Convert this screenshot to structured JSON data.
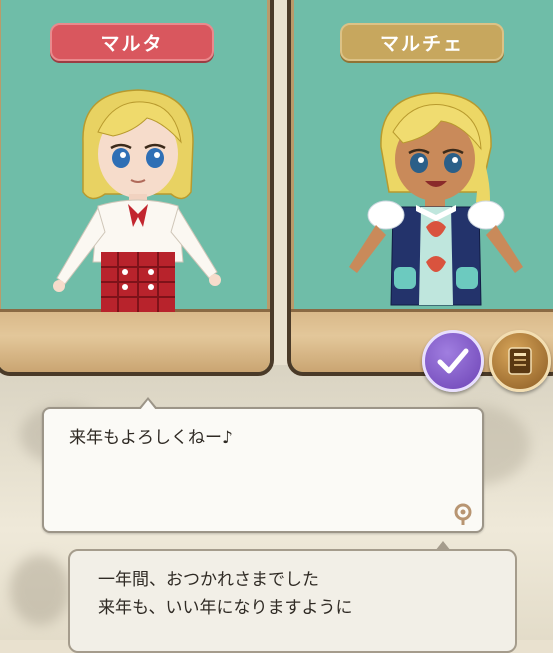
{
  "characters": {
    "left": {
      "name": "マルタ",
      "tag_color": "#d9575e"
    },
    "right": {
      "name": "マルチェ",
      "tag_color": "#c7a75e"
    }
  },
  "controls": {
    "confirm_icon": "check-icon",
    "log_icon": "log-book-icon"
  },
  "dialogue": {
    "speech": "来年もよろしくねー♪",
    "message_lines": [
      "一年間、おつかれさまでした",
      "来年も、いい年になりますように"
    ]
  },
  "colors": {
    "panel_bg": "#6fbda8",
    "frame": "#4a3a28"
  }
}
